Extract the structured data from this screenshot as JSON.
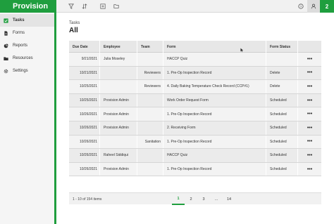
{
  "app": {
    "logo": "Provision"
  },
  "toolbar": {
    "icons": [
      "filter-icon",
      "sort-icon",
      "add-icon",
      "folder-icon"
    ],
    "notification_count": "2"
  },
  "sidebar": {
    "items": [
      {
        "label": "Tasks",
        "icon": "check-icon",
        "active": true
      },
      {
        "label": "Forms",
        "icon": "document-icon",
        "active": false
      },
      {
        "label": "Reports",
        "icon": "chart-icon",
        "active": false
      },
      {
        "label": "Resources",
        "icon": "folder-icon",
        "active": false
      },
      {
        "label": "Settings",
        "icon": "gear-icon",
        "active": false
      }
    ]
  },
  "main": {
    "breadcrumb": "Tasks",
    "title": "All"
  },
  "table": {
    "headers": {
      "due_date": "Due Date",
      "employee": "Employee",
      "team": "Team",
      "form": "Form",
      "status": "Form Status"
    },
    "rows": [
      {
        "due_date": "9/21/2021",
        "employee": "Julia Moseley",
        "team": "",
        "form": "HACCP Quiz",
        "status": "",
        "action": "•••"
      },
      {
        "due_date": "10/21/2021",
        "employee": "",
        "team": "Reviewers",
        "form": "1. Pre-Op Inspection Record",
        "status": "Delete",
        "action": "•••"
      },
      {
        "due_date": "10/25/2021",
        "employee": "",
        "team": "Reviewers",
        "form": "4. Daily Baking Temperature Check Record (CCP#1)",
        "status": "Delete",
        "action": "•••"
      },
      {
        "due_date": "10/25/2021",
        "employee": "Provision Admin",
        "team": "",
        "form": "Work Order Request Form",
        "status": "Scheduled",
        "action": "•••"
      },
      {
        "due_date": "10/26/2021",
        "employee": "Provision Admin",
        "team": "",
        "form": "1. Pre-Op Inspection Record",
        "status": "Scheduled",
        "action": "•••"
      },
      {
        "due_date": "10/26/2021",
        "employee": "Provision Admin",
        "team": "",
        "form": "2. Receiving Form",
        "status": "Scheduled",
        "action": "•••"
      },
      {
        "due_date": "10/26/2021",
        "employee": "",
        "team": "Sanitation",
        "form": "1. Pre-Op Inspection Record",
        "status": "Scheduled",
        "action": "•••"
      },
      {
        "due_date": "10/26/2021",
        "employee": "Raheel Siddiqui",
        "team": "",
        "form": "HACCP Quiz",
        "status": "Scheduled",
        "action": "•••"
      },
      {
        "due_date": "10/26/2021",
        "employee": "Provision Admin",
        "team": "",
        "form": "1. Pre-Op Inspection Record",
        "status": "Scheduled",
        "action": "•••"
      }
    ]
  },
  "footer": {
    "count": "1 - 10 of 154 items",
    "pages": [
      "1",
      "2",
      "3",
      "...",
      "14"
    ],
    "current_page": "1"
  },
  "colors": {
    "brand": "#1f9e3e"
  }
}
